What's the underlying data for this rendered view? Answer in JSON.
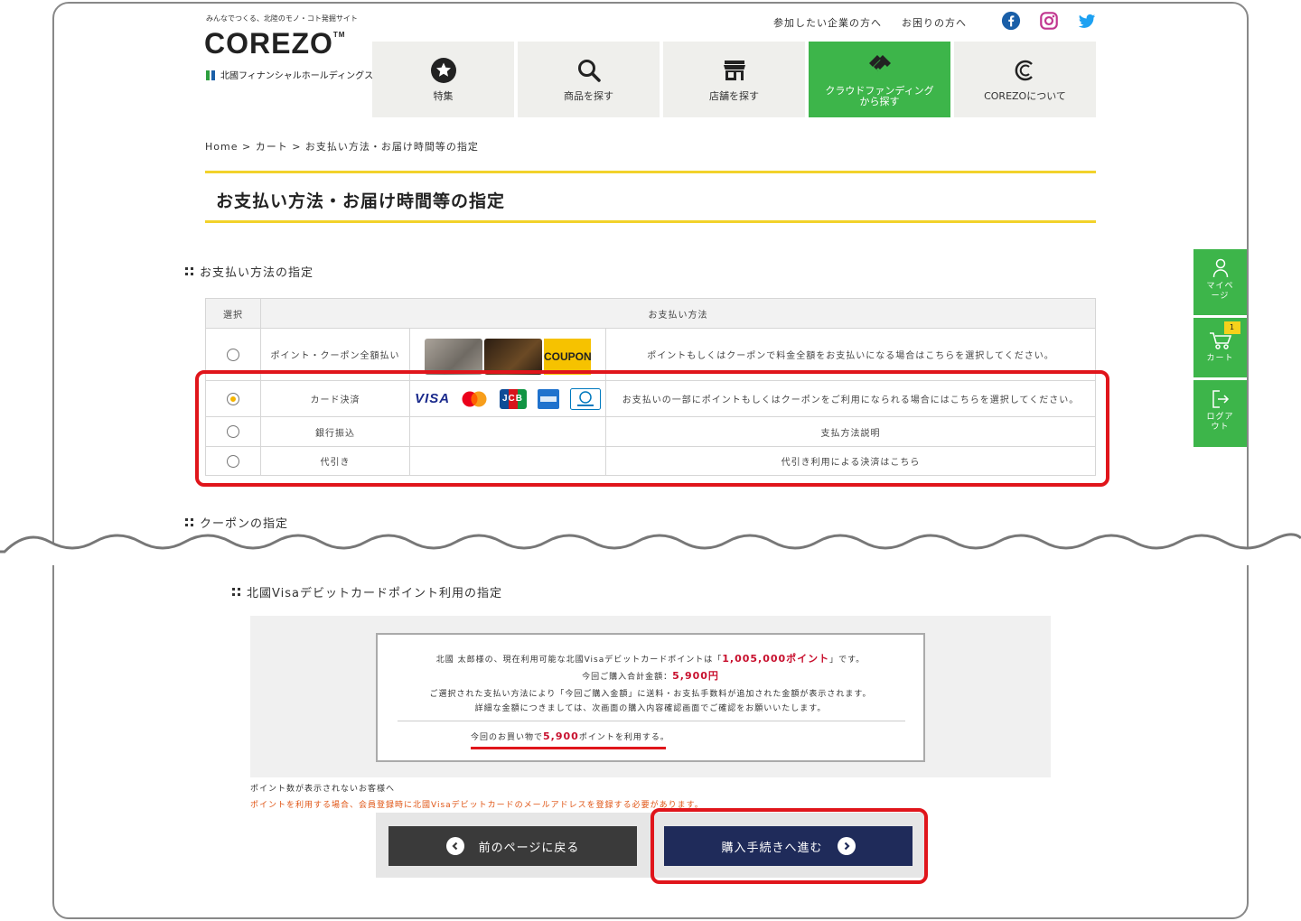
{
  "header": {
    "tagline": "みんなでつくる、北陸のモノ・コト発掘サイト",
    "logo": "COREZO",
    "logo_tm": "TM",
    "subbrand": "北國フィナンシャルホールディングス",
    "toplinks": [
      "参加したい企業の方へ",
      "お困りの方へ"
    ],
    "social": [
      "facebook-icon",
      "instagram-icon",
      "twitter-icon"
    ],
    "colors": {
      "green": "#3db54a",
      "yellow": "#f2d22b",
      "red": "#e0151b",
      "navy": "#1f2b5a"
    }
  },
  "nav": {
    "items": [
      {
        "label": "特集",
        "icon": "star-icon"
      },
      {
        "label": "商品を探す",
        "icon": "search-icon"
      },
      {
        "label": "店舗を探す",
        "icon": "store-icon"
      },
      {
        "label": "クラウドファンディング",
        "label2": "から探す",
        "icon": "handshake-icon"
      },
      {
        "label": "COREZOについて",
        "icon": "corezo-c-icon"
      }
    ]
  },
  "breadcrumb": "Home > カート > お支払い方法・お届け時間等の指定",
  "page_title": "お支払い方法・お届け時間等の指定",
  "payment": {
    "section_title": "お支払い方法の指定",
    "col_select": "選択",
    "col_method": "お支払い方法",
    "rows": [
      {
        "name": "ポイント・クーポン全額払い",
        "desc": "ポイントもしくはクーポンで料金全額をお支払いになる場合はこちらを選択してください。",
        "coupon": "COUPON"
      },
      {
        "name": "カード決済",
        "desc": "お支払いの一部にポイントもしくはクーポンをご利用になられる場合にはこちらを選択してください。",
        "brands": [
          "VISA",
          "JCB"
        ]
      },
      {
        "name": "銀行振込",
        "desc": "支払方法説明"
      },
      {
        "name": "代引き",
        "desc": "代引き利用による決済はこちら"
      }
    ]
  },
  "coupon_section": {
    "title": "クーポンの指定"
  },
  "points": {
    "title": "北國Visaデビットカードポイント利用の指定",
    "line1_a": "北國 太郎様の、現在利用可能な北國Visaデビットカードポイントは「",
    "line1_val": "1,005,000ポイント",
    "line1_b": "」です。",
    "line2_a": "今回ご購入合計金額：",
    "line2_val": "5,900円",
    "line3": "ご選択された支払い方法により「今回ご購入金額」に送料・お支払手数料が追加された金額が表示されます。",
    "line4": "詳細な金額につきましては、次画面の購入内容確認画面でご確認をお願いいたします。",
    "use_a": "今回のお買い物で",
    "use_val": "5,900",
    "use_b": "ポイントを利用する。",
    "note1": "ポイント数が表示されないお客様へ",
    "note2": "ポイントを利用する場合、会員登録時に北國Visaデビットカードのメールアドレスを登録する必要があります。"
  },
  "buttons": {
    "back": "前のページに戻る",
    "next": "購入手続きへ進む"
  },
  "side": {
    "mypage_1": "マイペ",
    "mypage_2": "ージ",
    "cart": "カート",
    "cart_count": "1",
    "logout_1": "ログア",
    "logout_2": "ウト"
  }
}
